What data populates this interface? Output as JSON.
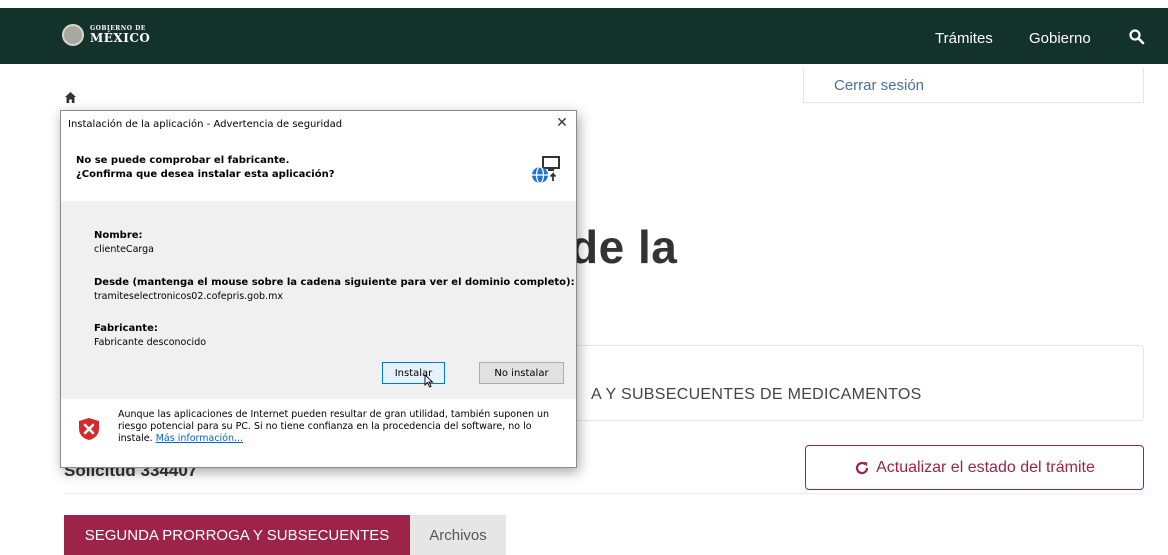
{
  "header": {
    "logo_top": "GOBIERNO DE",
    "logo_bottom": "MÉXICO",
    "nav": [
      "Trámites",
      "Gobierno"
    ],
    "search_icon": "search-icon",
    "background": "#13322b"
  },
  "account": {
    "logout_label": "Cerrar sesión"
  },
  "page": {
    "title_fragment": "de la",
    "tramite_fragment": "A Y SUBSECUENTES DE MEDICAMENTOS",
    "request_label": "Solicitud 334407",
    "refresh_button": "Actualizar el estado del trámite",
    "tabs": [
      "SEGUNDA PRORROGA Y SUBSECUENTES",
      "Archivos"
    ],
    "accent": "#9d2449"
  },
  "dialog": {
    "title": "Instalación de la aplicación - Advertencia de seguridad",
    "heading_line1": "No se puede comprobar el fabricante.",
    "heading_line2": "¿Confirma que desea instalar esta aplicación?",
    "name_label": "Nombre:",
    "name_value": "clienteCarga",
    "from_label": "Desde (mantenga el mouse sobre la cadena siguiente para ver el dominio completo):",
    "from_value": "tramiteselectronicos02.cofepris.gob.mx",
    "publisher_label": "Fabricante:",
    "publisher_value": "Fabricante desconocido",
    "install_button": "Instalar",
    "noinstall_button": "No instalar",
    "warning_text": "Aunque las aplicaciones de Internet pueden resultar de gran utilidad, también suponen un riesgo potencial para su PC. Si no tiene confianza en la procedencia del software, no lo instale.",
    "more_info_link": "Más información..."
  }
}
